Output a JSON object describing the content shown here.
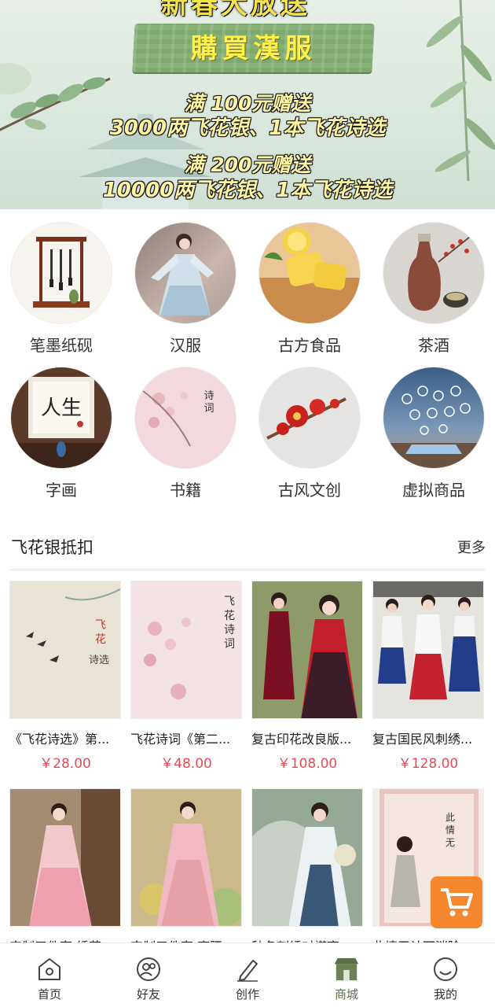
{
  "banner": {
    "top_title": "新春大放送",
    "plaque": "購買漢服",
    "promo1_title": "满 100元赠送",
    "promo1_detail": "3000两飞花银、1本飞花诗选",
    "promo2_title": "满 200元赠送",
    "promo2_detail": "10000两飞花银、1本飞花诗选"
  },
  "categories": [
    {
      "label": "笔墨纸砚",
      "icon": "brush-rack-photo"
    },
    {
      "label": "汉服",
      "icon": "hanfu-photo"
    },
    {
      "label": "古方食品",
      "icon": "pastry-photo"
    },
    {
      "label": "茶酒",
      "icon": "tea-wine-photo"
    },
    {
      "label": "字画",
      "icon": "calligraphy-photo"
    },
    {
      "label": "书籍",
      "icon": "book-photo"
    },
    {
      "label": "古风文创",
      "icon": "craft-photo"
    },
    {
      "label": "虚拟商品",
      "icon": "virtual-goods-photo"
    }
  ],
  "section": {
    "title": "飞花银抵扣",
    "more": "更多"
  },
  "products": [
    {
      "name": "《飞花诗选》第...",
      "price": "￥28.00",
      "image": "book-cover-swallows"
    },
    {
      "name": "飞花诗词《第二...",
      "price": "￥48.00",
      "image": "book-cover-blossoms"
    },
    {
      "name": "复古印花改良版...",
      "price": "￥108.00",
      "image": "red-hanfu-models"
    },
    {
      "name": "复古国民风刺绣...",
      "price": "￥128.00",
      "image": "blue-red-uniform-models"
    },
    {
      "name": "宋制三件套 绣花...",
      "price": "",
      "image": "pink-hanfu-model"
    },
    {
      "name": "宋制三件套 齐腰...",
      "price": "",
      "image": "pink-garden-model"
    },
    {
      "name": "秋冬刺绣对襟齐...",
      "price": "",
      "image": "blue-hanfu-model"
    },
    {
      "name": "此情无计可消除...",
      "price": "",
      "image": "poetry-book-cover"
    }
  ],
  "tabbar": {
    "items": [
      {
        "label": "首页",
        "icon": "home-icon"
      },
      {
        "label": "好友",
        "icon": "friends-icon"
      },
      {
        "label": "创作",
        "icon": "pen-icon"
      },
      {
        "label": "商城",
        "icon": "store-icon"
      },
      {
        "label": "我的",
        "icon": "profile-icon"
      }
    ],
    "active": "商城"
  },
  "colors": {
    "accent": "#5b6e49",
    "price": "#e04c57",
    "cart": "#f5872f"
  }
}
